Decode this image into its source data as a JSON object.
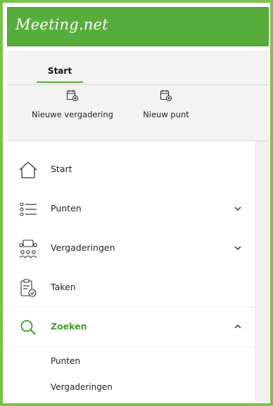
{
  "app": {
    "logo_text": "Meeting.net",
    "brand_color": "#57ad3b",
    "frame_color": "#7cc34a"
  },
  "ribbon": {
    "tabs": [
      {
        "label": "Start",
        "active": true
      }
    ],
    "buttons": [
      {
        "label": "Nieuwe vergadering",
        "icon": "calendar-add-icon"
      },
      {
        "label": "Nieuw punt",
        "icon": "calendar-add-icon"
      }
    ]
  },
  "nav": {
    "items": [
      {
        "label": "Start",
        "icon": "home-icon",
        "expandable": false
      },
      {
        "label": "Punten",
        "icon": "list-icon",
        "expandable": true,
        "expanded": false
      },
      {
        "label": "Vergaderingen",
        "icon": "meeting-people-icon",
        "expandable": true,
        "expanded": false
      },
      {
        "label": "Taken",
        "icon": "clipboard-check-icon",
        "expandable": false
      },
      {
        "label": "Zoeken",
        "icon": "search-icon",
        "expandable": true,
        "expanded": true,
        "active": true,
        "children": [
          {
            "label": "Punten"
          },
          {
            "label": "Vergaderingen"
          }
        ]
      }
    ],
    "active_color": "#3f9d2a"
  }
}
